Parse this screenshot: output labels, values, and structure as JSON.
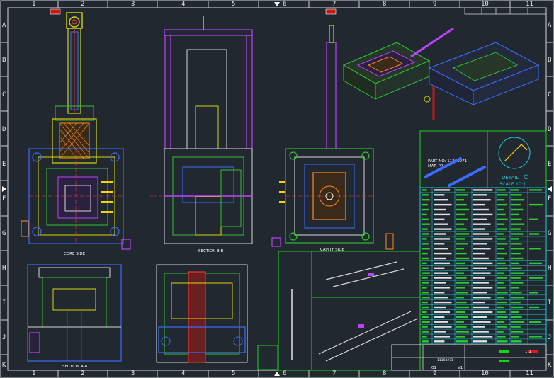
{
  "drawing": {
    "columns": [
      "1",
      "2",
      "3",
      "4",
      "5",
      "6",
      "7",
      "8",
      "9",
      "10",
      "11"
    ],
    "rows": [
      "A",
      "B",
      "C",
      "D",
      "E",
      "F",
      "G",
      "H",
      "I",
      "J",
      "K"
    ],
    "views": {
      "core_side": "CORE SIDE",
      "section_bb": "SECTION B-B",
      "cavity_side": "CAVITY SIDE",
      "section_aa": "SECTION A-A"
    },
    "part_info": {
      "part_no": "PART NO: 11368271",
      "material": "MAT: PP"
    },
    "detail": {
      "title": "DETAIL",
      "letter": "C",
      "scale": "SCALE 10:1"
    },
    "title_block": {
      "scale": "1:1",
      "drawing_no": "11368271",
      "sheet": "01",
      "version": "V1"
    }
  },
  "colors": {
    "background": "#212830",
    "frame": "#ffffff",
    "table_cyan": "#1ec8d8",
    "table_green": "#2ee82e",
    "title_green": "#16d616",
    "marker_red": "#e01a1a"
  }
}
